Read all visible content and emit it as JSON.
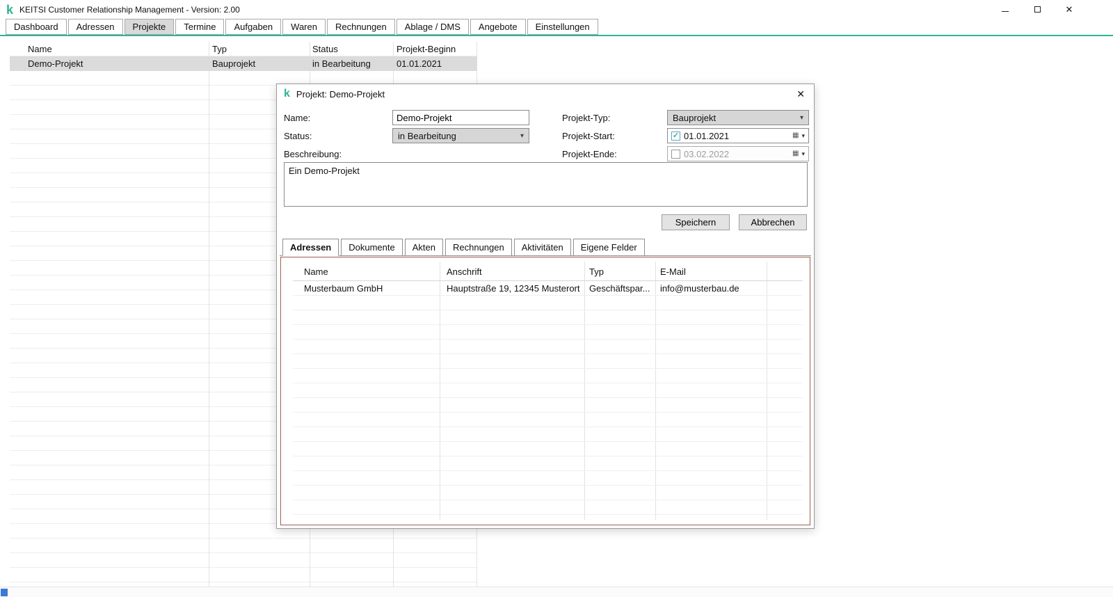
{
  "window": {
    "logo_text": "k",
    "title": "KEITSI Customer Relationship Management - Version: 2.00"
  },
  "icons": {
    "close": "✕",
    "chevron_down": "▾",
    "calendar": "▦",
    "check": "✓"
  },
  "nav": {
    "tabs": [
      {
        "label": "Dashboard",
        "selected": false
      },
      {
        "label": "Adressen",
        "selected": false
      },
      {
        "label": "Projekte",
        "selected": true
      },
      {
        "label": "Termine",
        "selected": false
      },
      {
        "label": "Aufgaben",
        "selected": false
      },
      {
        "label": "Waren",
        "selected": false
      },
      {
        "label": "Rechnungen",
        "selected": false
      },
      {
        "label": "Ablage / DMS",
        "selected": false
      },
      {
        "label": "Angebote",
        "selected": false
      },
      {
        "label": "Einstellungen",
        "selected": false
      }
    ]
  },
  "projects_table": {
    "columns": [
      "Name",
      "Typ",
      "Status",
      "Projekt-Beginn"
    ],
    "rows": [
      {
        "name": "Demo-Projekt",
        "typ": "Bauprojekt",
        "status": "in Bearbeitung",
        "beginn": "01.01.2021",
        "selected": true
      }
    ]
  },
  "dialog": {
    "logo_text": "k",
    "title": "Projekt: Demo-Projekt",
    "fields": {
      "name_label": "Name:",
      "name_value": "Demo-Projekt",
      "projekt_typ_label": "Projekt-Typ:",
      "projekt_typ_value": "Bauprojekt",
      "status_label": "Status:",
      "status_value": "in Bearbeitung",
      "projekt_start_label": "Projekt-Start:",
      "projekt_start_value": "01.01.2021",
      "projekt_start_checked": true,
      "projekt_ende_label": "Projekt-Ende:",
      "projekt_ende_value": "03.02.2022",
      "projekt_ende_checked": false,
      "beschreibung_label": "Beschreibung:",
      "beschreibung_value": "Ein Demo-Projekt"
    },
    "buttons": {
      "save": "Speichern",
      "cancel": "Abbrechen"
    },
    "tabs": [
      {
        "label": "Adressen",
        "selected": true
      },
      {
        "label": "Dokumente",
        "selected": false
      },
      {
        "label": "Akten",
        "selected": false
      },
      {
        "label": "Rechnungen",
        "selected": false
      },
      {
        "label": "Aktivitäten",
        "selected": false
      },
      {
        "label": "Eigene Felder",
        "selected": false
      }
    ],
    "addresses_table": {
      "columns": [
        "Name",
        "Anschrift",
        "Typ",
        "E-Mail"
      ],
      "rows": [
        {
          "name": "Musterbaum GmbH",
          "anschrift": "Hauptstraße 19, 12345 Musterort",
          "typ": "Geschäftspar...",
          "email": "info@musterbau.de"
        }
      ]
    }
  },
  "colors": {
    "accent": "#2eb593",
    "selected_row": "#dbdbdb",
    "panel_border": "#9e5d50"
  }
}
